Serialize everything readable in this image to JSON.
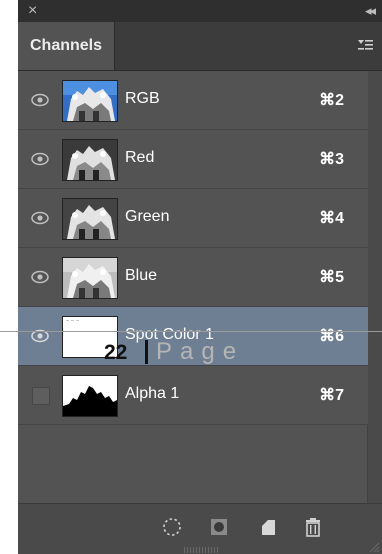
{
  "panel": {
    "title": "Channels",
    "close_glyph": "×",
    "collapse_glyph": "◂◂",
    "menu_icon": "panel-menu-icon"
  },
  "channels": [
    {
      "name": "RGB",
      "shortcut": "⌘2",
      "visible": true,
      "selected": false,
      "thumb": "color"
    },
    {
      "name": "Red",
      "shortcut": "⌘3",
      "visible": true,
      "selected": false,
      "thumb": "gray"
    },
    {
      "name": "Green",
      "shortcut": "⌘4",
      "visible": true,
      "selected": false,
      "thumb": "gray"
    },
    {
      "name": "Blue",
      "shortcut": "⌘5",
      "visible": true,
      "selected": false,
      "thumb": "gray"
    },
    {
      "name": "Spot Color 1",
      "shortcut": "⌘6",
      "visible": true,
      "selected": true,
      "thumb": "white"
    },
    {
      "name": "Alpha 1",
      "shortcut": "⌘7",
      "visible": false,
      "selected": false,
      "thumb": "mask"
    }
  ],
  "bottom_toolbar": {
    "icons": [
      "load-selection-icon",
      "save-selection-icon",
      "new-channel-icon",
      "delete-channel-icon"
    ]
  },
  "overlay": {
    "page_number": "22",
    "page_word": "Page"
  },
  "colors": {
    "panel_bg": "#535353",
    "selected_row": "#6e7f93",
    "text": "#ffffff"
  }
}
